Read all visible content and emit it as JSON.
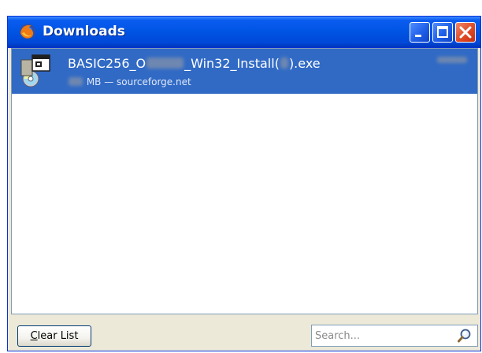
{
  "window": {
    "title": "Downloads",
    "controls": {
      "minimize": "minimize-icon",
      "maximize": "maximize-icon",
      "close": "close-icon"
    }
  },
  "downloads": [
    {
      "filename_prefix": "BASIC256_O",
      "filename_middle": "_Win32_Install(",
      "filename_suffix": ").exe",
      "status_suffix": "MB — sourceforge.net",
      "icon": "installer-file-icon"
    }
  ],
  "footer": {
    "clear_button_first": "C",
    "clear_button_rest": "lear List",
    "search_placeholder": "Search..."
  },
  "colors": {
    "titlebar": "#0054e3",
    "selection": "#316ac5",
    "frame": "#ece9d8",
    "close_button": "#e04a25"
  }
}
